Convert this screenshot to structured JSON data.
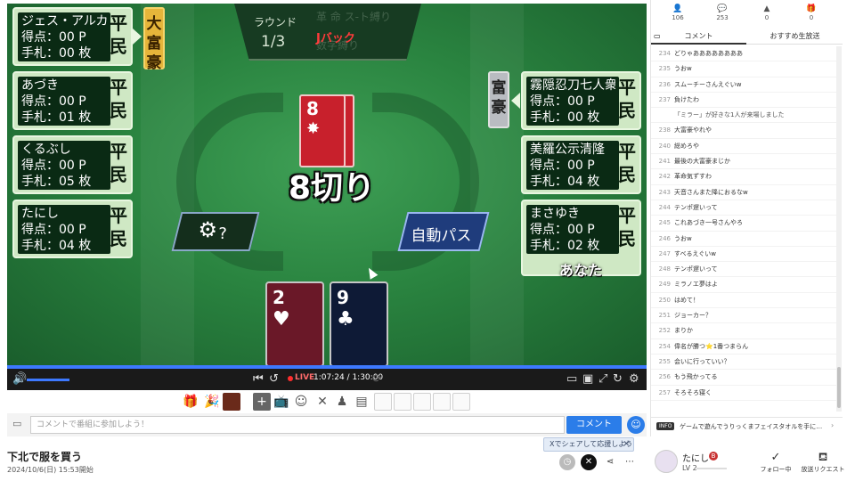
{
  "game": {
    "round_label": "ラウンド",
    "round_value": "1/3",
    "rule_text_ghost": [
      "革 命 ス-ト縛り",
      "数字縛り"
    ],
    "jpack_label": "Jバック",
    "eight_cut_label": "8切り",
    "center_card": {
      "number": "8",
      "suit": "✸"
    },
    "settings_icon": "gear-icon",
    "settings_question": "?",
    "auto_pass_label": "自動パス",
    "you_label": "あなた",
    "score_prefix": "得点：",
    "hand_prefix": "手札：",
    "players_left": [
      {
        "name": "ジェス・アルカー",
        "score": "得点：00 P",
        "hand": "手札：00 枚",
        "rank": "平民",
        "badge": "大富豪"
      },
      {
        "name": "あづき",
        "score": "得点：00 P",
        "hand": "手札：01 枚",
        "rank": "平民"
      },
      {
        "name": "くるぶし",
        "score": "得点：00 P",
        "hand": "手札：05 枚",
        "rank": "平民"
      },
      {
        "name": "たにし",
        "score": "得点：00 P",
        "hand": "手札：04 枚",
        "rank": "平民"
      }
    ],
    "players_right": [
      {
        "name": "霧隠忍刀七人衆干柿",
        "score": "得点：00 P",
        "hand": "手札：00 枚",
        "rank": "平民",
        "badge": "富豪"
      },
      {
        "name": "美羅公示清隆",
        "score": "得点：00 P",
        "hand": "手札：04 枚",
        "rank": "平民"
      },
      {
        "name": "まさゆき",
        "score": "得点：00 P",
        "hand": "手札：02 枚",
        "rank": "平民"
      }
    ],
    "hand_cards": [
      {
        "number": "2",
        "suit": "♥",
        "color": "#6a1828"
      },
      {
        "number": "9",
        "suit": "♣",
        "color": "#0e1a36"
      }
    ]
  },
  "player": {
    "live_label": "LIVE",
    "timecode": "1:07:24 / 1:30:00",
    "progress": 1.0
  },
  "comment_bar": {
    "placeholder": "コメントで番組に参加しよう！",
    "button_label": "コメント"
  },
  "stream": {
    "title": "下北で服を買う",
    "datetime": "2024/10/6(日) 15:53開始",
    "share_tip": "Xでシェアして応援しよう",
    "streamer_name": "たにし",
    "streamer_level": "LV 2",
    "follow_label": "フォロー中",
    "request_label": "放送リクエスト"
  },
  "sidebar": {
    "stats": [
      {
        "icon": "viewer-icon",
        "value": "106"
      },
      {
        "icon": "comment-icon",
        "value": "253"
      },
      {
        "icon": "ad-icon",
        "value": "0"
      },
      {
        "icon": "gift-icon",
        "value": "0"
      }
    ],
    "tab_comment": "コメント",
    "tab_recommend": "おすすめ生放送",
    "comments": [
      {
        "n": "234",
        "t": "どりゃああああああああ"
      },
      {
        "n": "235",
        "t": "うおw"
      },
      {
        "n": "236",
        "t": "スムーチーさんえぐいw"
      },
      {
        "n": "237",
        "t": "負けたわ"
      },
      {
        "n": "",
        "t": "「ミラー」が好きな1人が来場しました"
      },
      {
        "n": "238",
        "t": "大富豪やれや"
      },
      {
        "n": "240",
        "t": "総めろや"
      },
      {
        "n": "241",
        "t": "最後の大富豪まじか"
      },
      {
        "n": "242",
        "t": "革命気ずすわ"
      },
      {
        "n": "243",
        "t": "天音さんまた降におるなw"
      },
      {
        "n": "244",
        "t": "テンポ遅いって"
      },
      {
        "n": "245",
        "t": "これあづき一号さんやろ"
      },
      {
        "n": "246",
        "t": "うおw"
      },
      {
        "n": "247",
        "t": "すべるえぐいw"
      },
      {
        "n": "248",
        "t": "テンポ遅いって"
      },
      {
        "n": "249",
        "t": "ミラノエ夢はよ"
      },
      {
        "n": "250",
        "t": "はめて！"
      },
      {
        "n": "251",
        "t": "ジョーカー？"
      },
      {
        "n": "252",
        "t": "まりか"
      },
      {
        "n": "254",
        "t": "偉名が勝つ⭐1番つまらん"
      },
      {
        "n": "255",
        "t": "会いに行っていい？"
      },
      {
        "n": "256",
        "t": "もう飛かってる"
      },
      {
        "n": "257",
        "t": "そろそろ寝く"
      }
    ],
    "info_badge": "INFO",
    "info_text": "ゲームで遊んでうりっくまフェイスタオルを手に…"
  }
}
